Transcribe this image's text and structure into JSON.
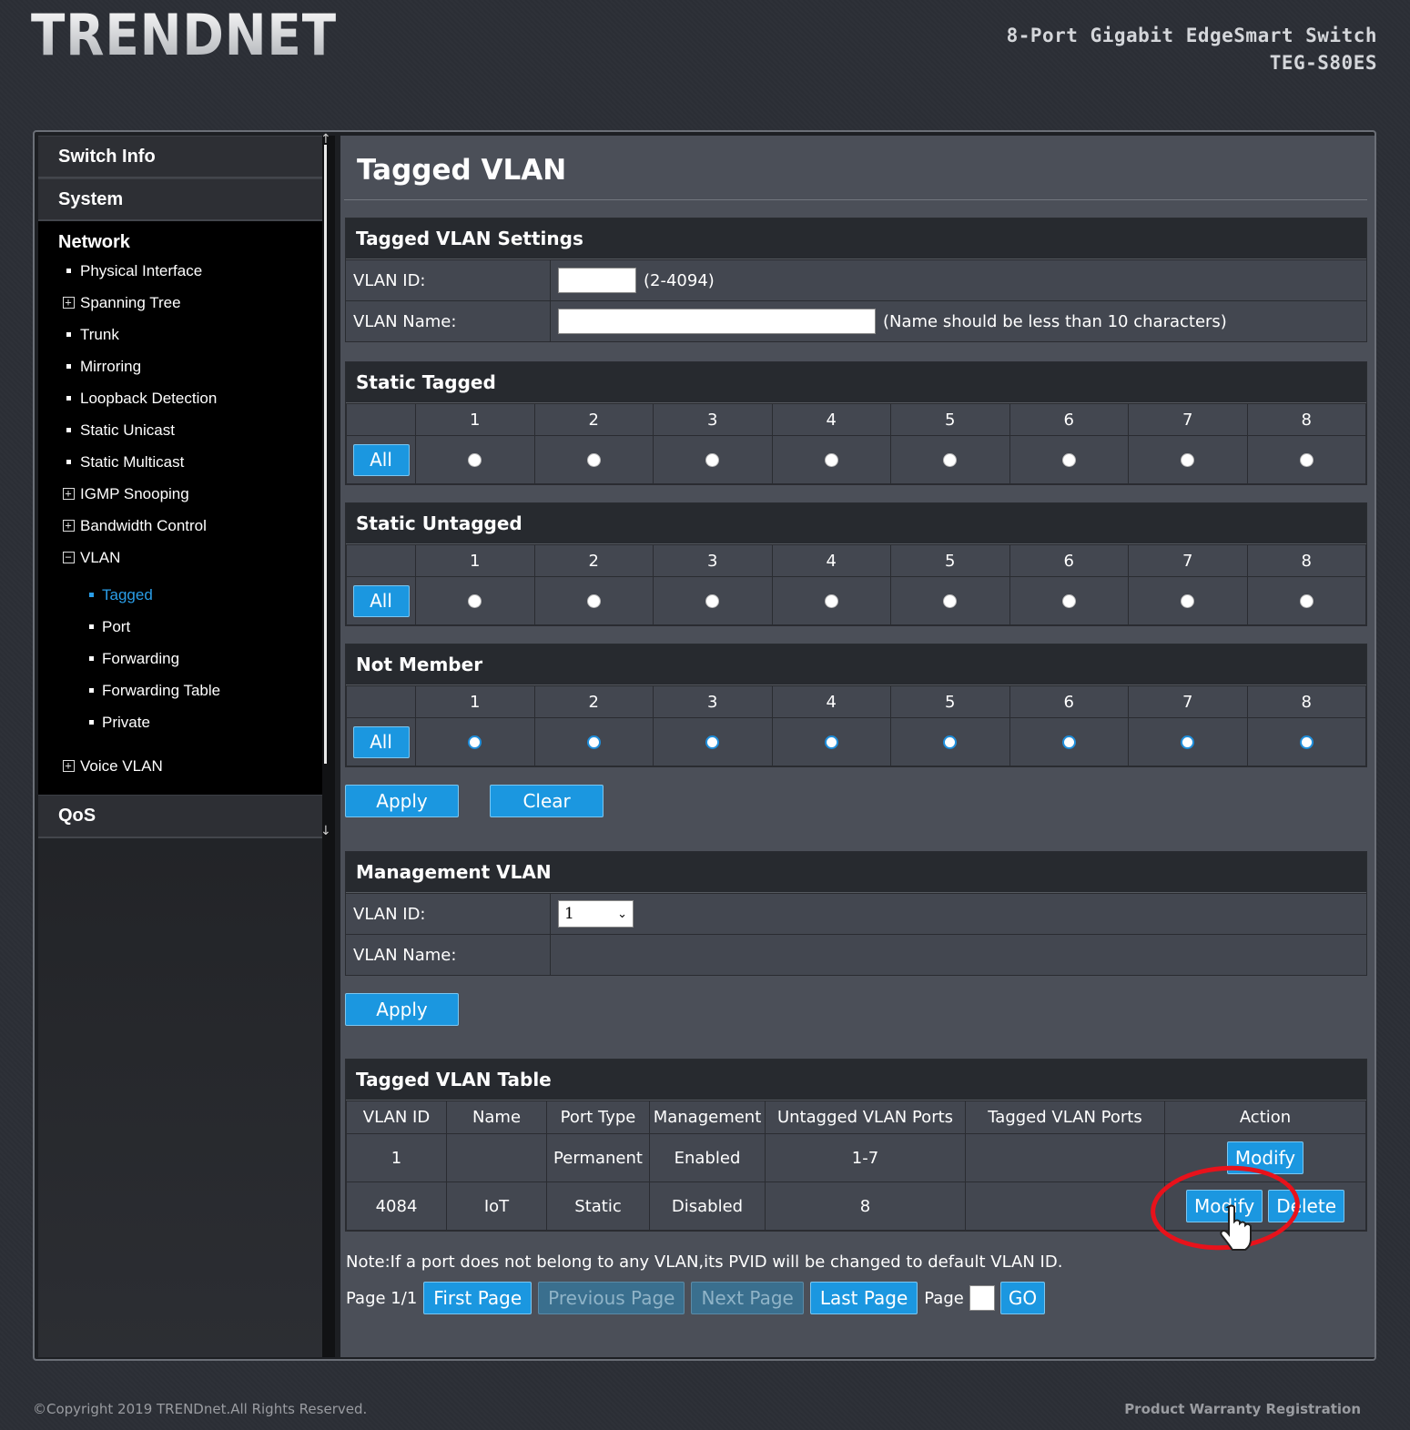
{
  "header": {
    "logo_text": "TRENDnet",
    "product_name": "8-Port Gigabit EdgeSmart Switch",
    "model": "TEG-S80ES"
  },
  "sidebar": {
    "switch_info": "Switch Info",
    "system": "System",
    "network": "Network",
    "network_items": [
      {
        "label": "Physical Interface",
        "marker": "bullet"
      },
      {
        "label": "Spanning Tree",
        "marker": "plus"
      },
      {
        "label": "Trunk",
        "marker": "bullet"
      },
      {
        "label": "Mirroring",
        "marker": "bullet"
      },
      {
        "label": "Loopback Detection",
        "marker": "bullet"
      },
      {
        "label": "Static Unicast",
        "marker": "bullet"
      },
      {
        "label": "Static Multicast",
        "marker": "bullet"
      },
      {
        "label": "IGMP Snooping",
        "marker": "plus"
      },
      {
        "label": "Bandwidth Control",
        "marker": "plus"
      },
      {
        "label": "VLAN",
        "marker": "minus"
      }
    ],
    "vlan_items": [
      {
        "label": "Tagged",
        "active": true
      },
      {
        "label": "Port"
      },
      {
        "label": "Forwarding"
      },
      {
        "label": "Forwarding Table"
      },
      {
        "label": "Private"
      }
    ],
    "voice_vlan": "Voice VLAN",
    "qos": "QoS"
  },
  "main": {
    "title": "Tagged VLAN",
    "settings": {
      "heading": "Tagged VLAN Settings",
      "vlan_id_label": "VLAN ID:",
      "vlan_id_value": "",
      "vlan_id_hint": "(2-4094)",
      "vlan_name_label": "VLAN Name:",
      "vlan_name_value": "",
      "vlan_name_hint": "(Name should be less than 10 characters)"
    },
    "port_groups": [
      {
        "heading": "Static Tagged",
        "all_label": "All",
        "selected": [
          false,
          false,
          false,
          false,
          false,
          false,
          false,
          false
        ]
      },
      {
        "heading": "Static Untagged",
        "all_label": "All",
        "selected": [
          false,
          false,
          false,
          false,
          false,
          false,
          false,
          false
        ]
      },
      {
        "heading": "Not Member",
        "all_label": "All",
        "selected": [
          true,
          true,
          true,
          true,
          true,
          true,
          true,
          true
        ]
      }
    ],
    "ports": [
      "1",
      "2",
      "3",
      "4",
      "5",
      "6",
      "7",
      "8"
    ],
    "apply_label": "Apply",
    "clear_label": "Clear",
    "management": {
      "heading": "Management VLAN",
      "vlan_id_label": "VLAN ID:",
      "vlan_id_selected": "1",
      "vlan_name_label": "VLAN Name:",
      "vlan_name_value": "",
      "apply_label": "Apply"
    },
    "vlan_table": {
      "heading": "Tagged VLAN Table",
      "columns": [
        "VLAN ID",
        "Name",
        "Port Type",
        "Management",
        "Untagged VLAN Ports",
        "Tagged VLAN Ports",
        "Action"
      ],
      "rows": [
        {
          "vlan_id": "1",
          "name": "",
          "port_type": "Permanent",
          "management": "Enabled",
          "untagged": "1-7",
          "tagged": "",
          "actions": [
            "Modify"
          ]
        },
        {
          "vlan_id": "4084",
          "name": "IoT",
          "port_type": "Static",
          "management": "Disabled",
          "untagged": "8",
          "tagged": "",
          "actions": [
            "Modify",
            "Delete"
          ]
        }
      ]
    },
    "note": "Note:If a port does not belong to any VLAN,its PVID will be changed to default VLAN ID.",
    "pager": {
      "page_info": "Page 1/1",
      "first": "First Page",
      "previous": "Previous Page",
      "next": "Next Page",
      "last": "Last Page",
      "page_label": "Page",
      "go": "GO"
    }
  },
  "footer": {
    "copyright": "©Copyright 2019 TRENDnet.All Rights Reserved.",
    "warranty": "Product Warranty Registration"
  },
  "colors": {
    "accent": "#1b97e0",
    "annotation": "#e8121b"
  }
}
